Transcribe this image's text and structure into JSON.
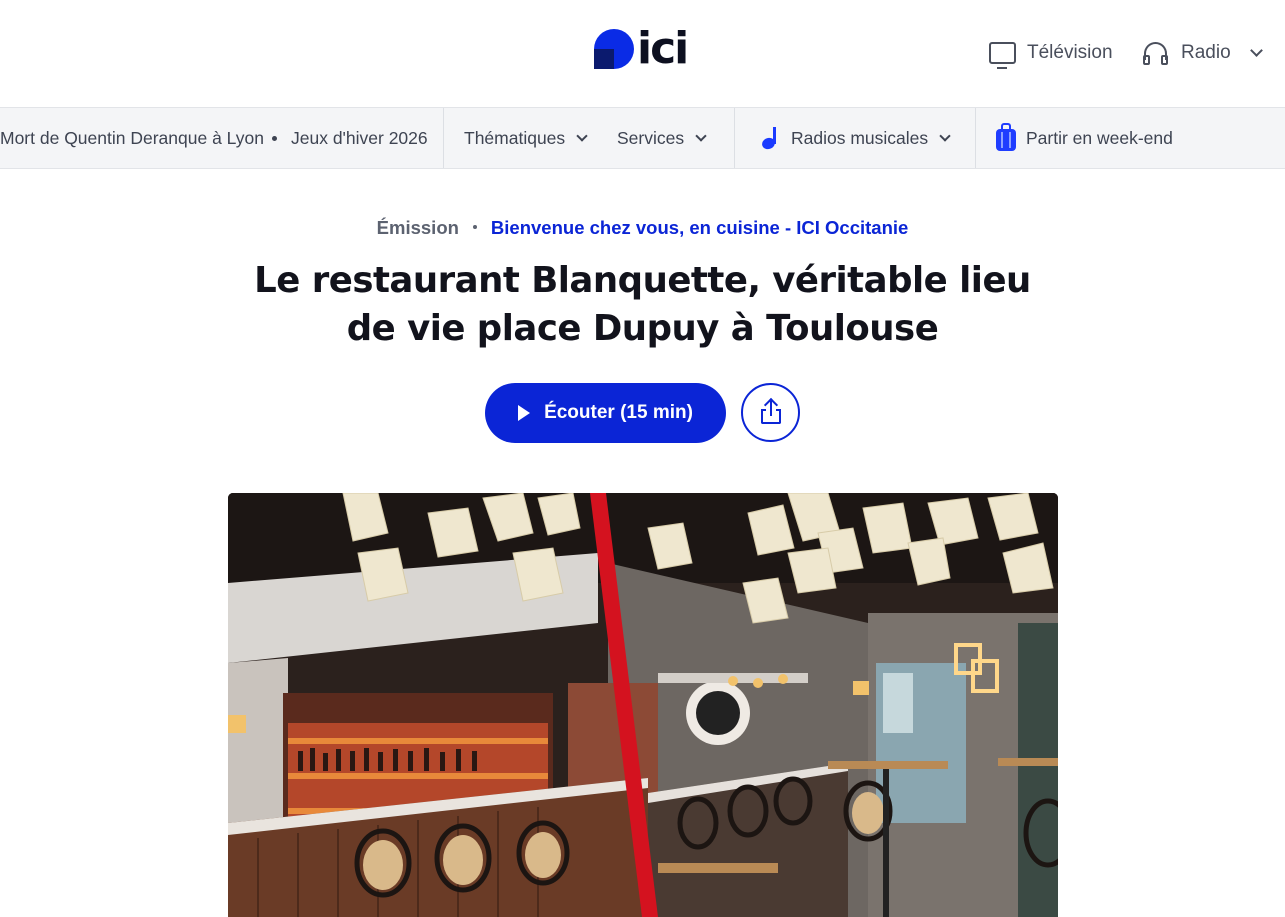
{
  "header": {
    "logo_text": "ici",
    "tv_label": "Télévision",
    "radio_label": "Radio"
  },
  "nav": {
    "topic1": "Mort de Quentin Deranque à Lyon",
    "topic2": "Jeux d'hiver 2026",
    "thematiques": "Thématiques",
    "services": "Services",
    "radios_musicales": "Radios musicales",
    "week_end": "Partir en week-end"
  },
  "article": {
    "type": "Émission",
    "show": "Bienvenue chez vous, en cuisine - ICI Occitanie",
    "title_line1": "Le restaurant Blanquette, véritable lieu",
    "title_line2": "de vie place Dupuy à Toulouse",
    "listen_label": "Écouter (15 min)"
  },
  "colors": {
    "brand_blue": "#0b25d6",
    "nav_bg": "#f4f5f7"
  },
  "icons": [
    "tv-icon",
    "headphones-icon",
    "chevron-down-icon",
    "music-note-icon",
    "suitcase-icon",
    "play-icon",
    "share-icon"
  ]
}
